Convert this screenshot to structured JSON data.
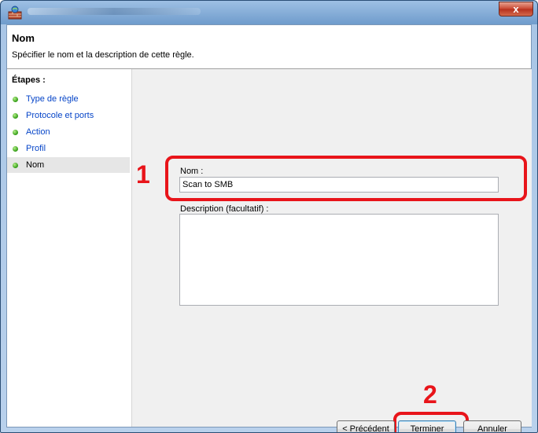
{
  "window": {
    "close_label": "x"
  },
  "header": {
    "title": "Nom",
    "subtitle": "Spécifier le nom et la description de cette règle."
  },
  "steps": {
    "title": "Étapes :",
    "items": [
      {
        "label": "Type de règle"
      },
      {
        "label": "Protocole et ports"
      },
      {
        "label": "Action"
      },
      {
        "label": "Profil"
      },
      {
        "label": "Nom"
      }
    ]
  },
  "form": {
    "name_label": "Nom :",
    "name_value": "Scan to SMB",
    "description_label": "Description (facultatif) :",
    "description_value": ""
  },
  "buttons": {
    "back": "< Précédent",
    "finish": "Terminer",
    "cancel": "Annuler"
  },
  "annotations": {
    "callout_1": "1",
    "callout_2": "2",
    "color": "#e8141a"
  }
}
